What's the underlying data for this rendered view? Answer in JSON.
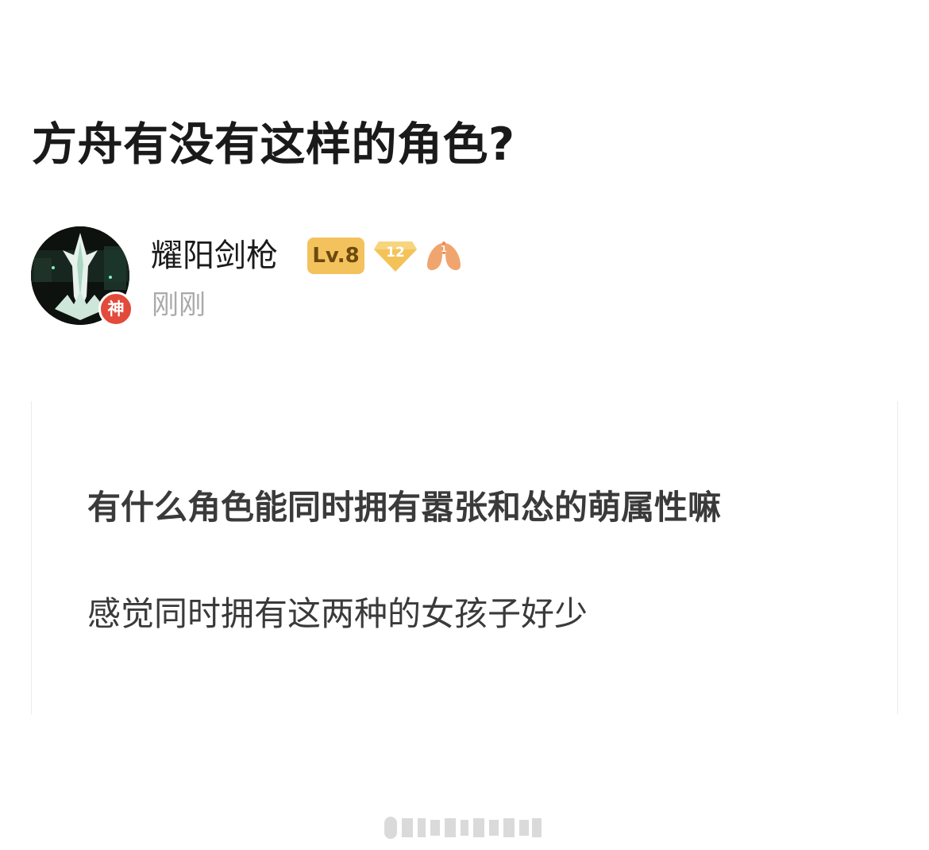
{
  "post": {
    "title": "方舟有没有这样的角色?",
    "author": {
      "name": "耀阳剑枪",
      "badge": "神",
      "level_label": "Lv.8",
      "diamond_number": "12",
      "lung_number": "1"
    },
    "timestamp": "刚刚",
    "body": {
      "line1": "有什么角色能同时拥有嚣张和怂的萌属性嘛",
      "line2": "感觉同时拥有这两种的女孩子好少"
    }
  },
  "icons": {
    "avatar": "sword-avatar-icon",
    "diamond": "diamond-icon",
    "lung": "lung-icon",
    "watermark": "watermark-icon"
  },
  "colors": {
    "level_badge": "#f4c25c",
    "god_badge": "#e24a3b",
    "diamond": "#f3c35a",
    "lung": "#f1a56e",
    "timestamp": "#aaaaaa"
  }
}
